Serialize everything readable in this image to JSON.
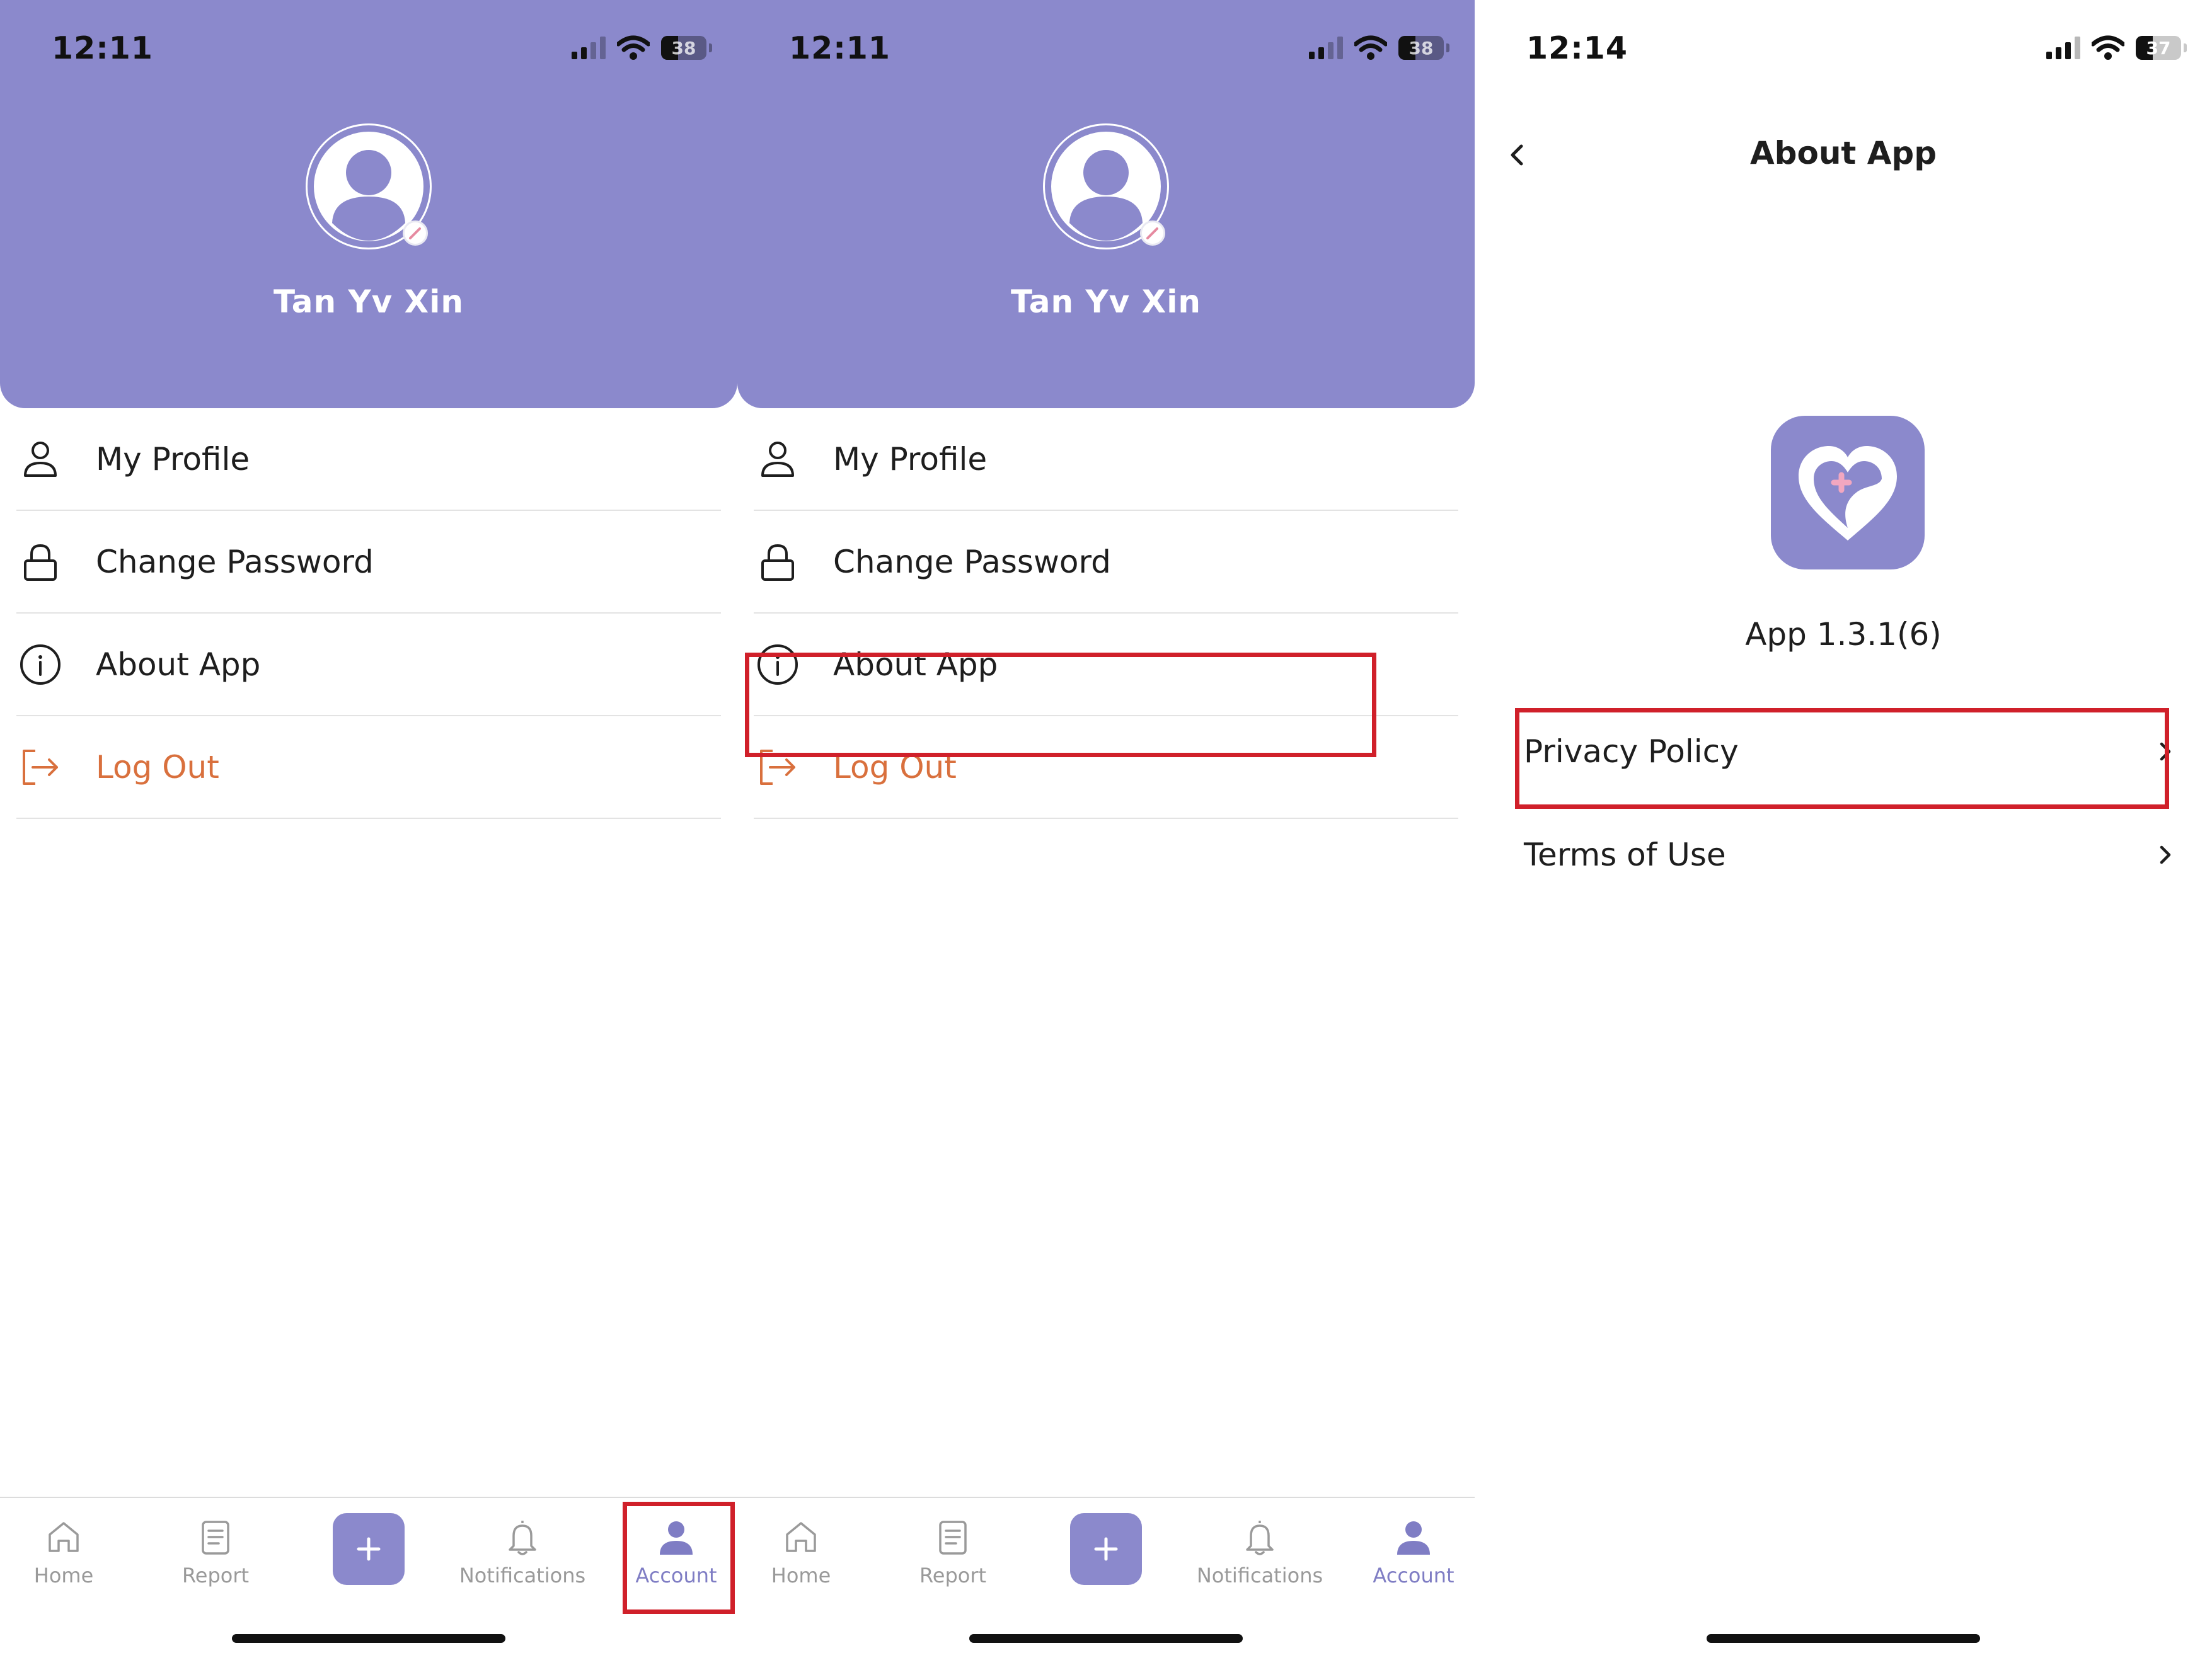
{
  "screens": [
    {
      "status": {
        "time": "12:11",
        "battery": "38"
      },
      "profile": {
        "name": "Tan Yv Xin"
      },
      "menu": [
        {
          "label": "My Profile",
          "icon": "person-icon"
        },
        {
          "label": "Change Password",
          "icon": "lock-icon"
        },
        {
          "label": "About App",
          "icon": "info-icon"
        },
        {
          "label": "Log Out",
          "icon": "logout-icon"
        }
      ],
      "tabs": [
        "Home",
        "Report",
        "Notifications",
        "Account"
      ],
      "active_tab": "Account",
      "highlight": "Account tab"
    },
    {
      "status": {
        "time": "12:11",
        "battery": "38"
      },
      "profile": {
        "name": "Tan Yv Xin"
      },
      "menu": [
        {
          "label": "My Profile",
          "icon": "person-icon"
        },
        {
          "label": "Change Password",
          "icon": "lock-icon"
        },
        {
          "label": "About App",
          "icon": "info-icon"
        },
        {
          "label": "Log Out",
          "icon": "logout-icon"
        }
      ],
      "tabs": [
        "Home",
        "Report",
        "Notifications",
        "Account"
      ],
      "active_tab": "Account",
      "highlight": "About App menu item"
    },
    {
      "status": {
        "time": "12:14",
        "battery": "37"
      },
      "title": "About App",
      "version": "App 1.3.1(6)",
      "links": [
        {
          "label": "Privacy Policy"
        },
        {
          "label": "Terms of Use"
        }
      ],
      "highlight": "Privacy Policy row"
    }
  ],
  "colors": {
    "header": "#8b89cc",
    "accent": "#7f7dc4",
    "logout": "#d9703d",
    "highlight": "#d0202a",
    "inactive_tab": "#9a9a9a"
  }
}
